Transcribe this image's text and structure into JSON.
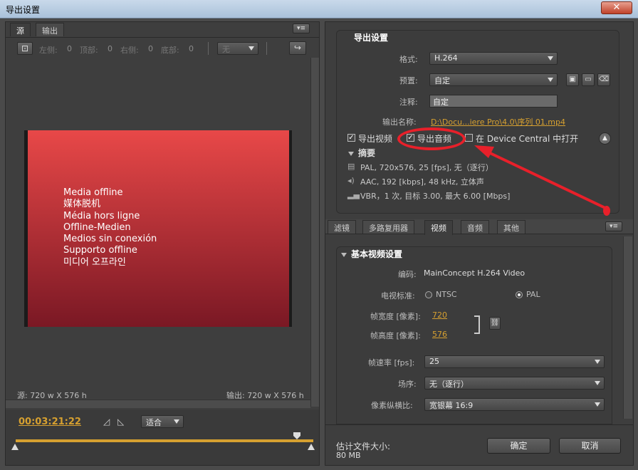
{
  "window": {
    "title": "导出设置",
    "close_symbol": "✕"
  },
  "left": {
    "tabs": [
      "源",
      "输出"
    ],
    "crop": {
      "left_label": "左侧:",
      "left_val": "0",
      "top_label": "顶部:",
      "top_val": "0",
      "right_label": "右侧:",
      "right_val": "0",
      "bottom_label": "底部:",
      "bottom_val": "0",
      "ratio": "无"
    },
    "offline_lines": [
      "Media offline",
      "媒体脱机",
      "Média hors ligne",
      "Offline-Medien",
      "Medios sin conexión",
      "Supporto offline",
      "미디어 오프라인"
    ],
    "source_size": "源: 720 w X 576 h",
    "output_size": "输出: 720 w X 576 h",
    "timecode": "00:03:21:22",
    "fit": "适合"
  },
  "export": {
    "header": "导出设置",
    "format_label": "格式:",
    "format": "H.264",
    "preset_label": "预置:",
    "preset": "自定",
    "comment_label": "注释:",
    "comment": "自定",
    "output_label": "输出名称:",
    "output_name": "D:\\Docu...iere Pro\\4.0\\序列 01.mp4",
    "export_video": "导出视频",
    "export_audio": "导出音频",
    "device_central": "在 Device Central 中打开",
    "summary_label": "摘要",
    "summary_video": "PAL, 720x576, 25 [fps], 无（逐行）",
    "summary_audio": "AAC, 192 [kbps], 48 kHz, 立体声",
    "summary_bitrate": "VBR，1 次, 目标 3.00, 最大 6.00 [Mbps]"
  },
  "settings_tabs": [
    "滤镜",
    "多路复用器",
    "视频",
    "音频",
    "其他"
  ],
  "video": {
    "header": "基本视频设置",
    "codec_label": "编码:",
    "codec": "MainConcept H.264 Video",
    "tv_label": "电视标准:",
    "ntsc": "NTSC",
    "pal": "PAL",
    "width_label": "帧宽度 [像素]:",
    "width": "720",
    "height_label": "帧高度 [像素]:",
    "height": "576",
    "fps_label": "帧速率 [fps]:",
    "fps": "25",
    "field_label": "场序:",
    "field": "无（逐行）",
    "aspect_label": "像素纵横比:",
    "aspect": "宽银幕 16:9"
  },
  "footer": {
    "size_label": "估计文件大小:",
    "size": "80 MB",
    "ok": "确定",
    "cancel": "取消"
  },
  "colors": {
    "accent": "#d6a030",
    "annotation": "#e8202a",
    "offline_top": "#e84848",
    "offline_bottom": "#7a1824"
  }
}
